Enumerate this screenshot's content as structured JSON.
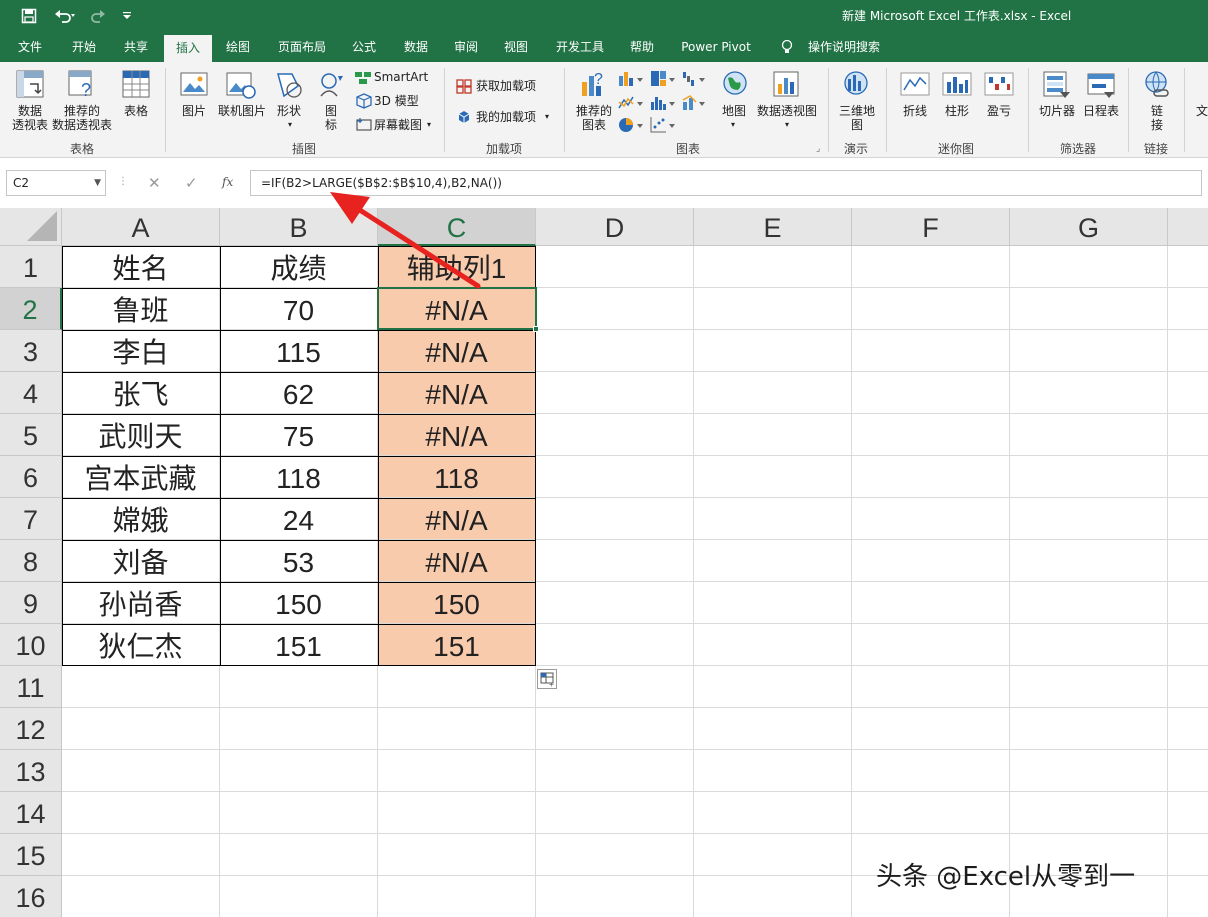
{
  "title_bar": {
    "title": "新建 Microsoft Excel 工作表.xlsx  -  Excel",
    "save_icon": "save-icon",
    "undo_icon": "undo-icon",
    "redo_icon": "redo-icon",
    "customize_icon": "customize-qat-icon"
  },
  "tabs": [
    "文件",
    "开始",
    "共享",
    "插入",
    "绘图",
    "页面布局",
    "公式",
    "数据",
    "审阅",
    "视图",
    "开发工具",
    "帮助",
    "Power Pivot",
    "操作说明搜索"
  ],
  "active_tab": "插入",
  "ribbon": {
    "tables": {
      "group": "表格",
      "pivot": "数据\n透视表",
      "recommended_pivot": "推荐的\n数据透视表",
      "table": "表格"
    },
    "illustrations": {
      "group": "插图",
      "picture": "图片",
      "online_picture": "联机图片",
      "shapes": "形状",
      "icons": "图\n标",
      "smartart": "SmartArt",
      "model3d": "3D 模型",
      "screenshot": "屏幕截图"
    },
    "addins": {
      "group": "加载项",
      "get": "获取加载项",
      "my": "我的加载项"
    },
    "charts": {
      "group": "图表",
      "recommended": "推荐的\n图表",
      "map": "地图",
      "pivot_chart": "数据透视图"
    },
    "tours": {
      "group": "演示",
      "map3d": "三维地\n图"
    },
    "sparklines": {
      "group": "迷你图",
      "line": "折线",
      "column": "柱形",
      "winloss": "盈亏"
    },
    "filters": {
      "group": "筛选器",
      "slicer": "切片器",
      "timeline": "日程表"
    },
    "links": {
      "group": "链接",
      "link": "链\n接"
    },
    "text": {
      "partial": "文"
    }
  },
  "formula_bar": {
    "name_box": "C2",
    "formula": "=IF(B2>LARGE($B$2:$B$10,4),B2,NA())",
    "cancel_symbol": "✕",
    "enter_symbol": "✓",
    "fx_label": "fx"
  },
  "columns": [
    "A",
    "B",
    "C",
    "D",
    "E",
    "F",
    "G"
  ],
  "rows": [
    "1",
    "2",
    "3",
    "4",
    "5",
    "6",
    "7",
    "8",
    "9",
    "10",
    "11",
    "12",
    "13",
    "14",
    "15",
    "16"
  ],
  "table": {
    "header": [
      "姓名",
      "成绩",
      "辅助列1"
    ],
    "rows": [
      [
        "鲁班",
        "70",
        "#N/A"
      ],
      [
        "李白",
        "115",
        "#N/A"
      ],
      [
        "张飞",
        "62",
        "#N/A"
      ],
      [
        "武则天",
        "75",
        "#N/A"
      ],
      [
        "宫本武藏",
        "118",
        "118"
      ],
      [
        "嫦娥",
        "24",
        "#N/A"
      ],
      [
        "刘备",
        "53",
        "#N/A"
      ],
      [
        "孙尚香",
        "150",
        "150"
      ],
      [
        "狄仁杰",
        "151",
        "151"
      ]
    ]
  },
  "selected_cell": "C2",
  "highlight_color": "#f8cbad",
  "accent_color": "#217346",
  "annotation_arrow_color": "#e8231f",
  "watermark": "头条 @Excel从零到一"
}
